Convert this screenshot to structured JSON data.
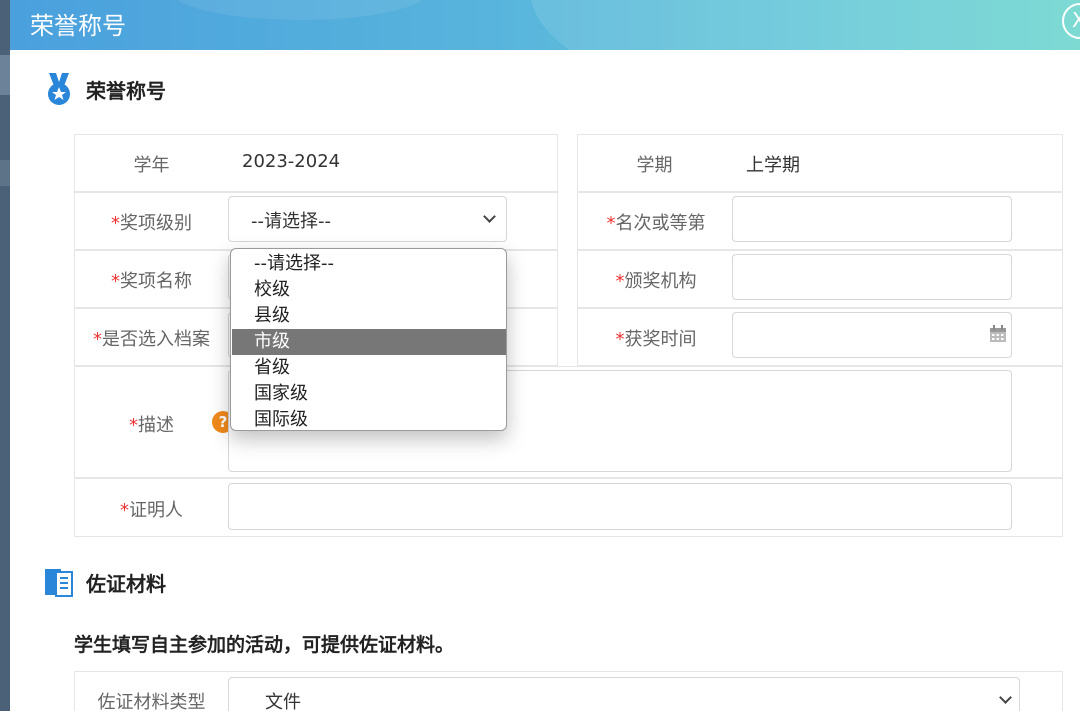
{
  "header": {
    "title": "荣誉称号",
    "close_label": "X"
  },
  "section_honor": {
    "title": "荣誉称号",
    "icon": "medal-icon"
  },
  "form": {
    "year_label": "学年",
    "year_value": "2023-2024",
    "term_label": "学期",
    "term_value": "上学期",
    "required_mark": "*",
    "award_level_label": "奖项级别",
    "award_level_selected": "--请选择--",
    "rank_label": "名次或等第",
    "award_name_label": "奖项名称",
    "issuer_label": "颁奖机构",
    "archive_label": "是否选入档案",
    "award_time_label": "获奖时间",
    "desc_label": "描述",
    "help_glyph": "?",
    "witness_label": "证明人"
  },
  "award_level_options": [
    "--请选择--",
    "校级",
    "县级",
    "市级",
    "省级",
    "国家级",
    "国际级"
  ],
  "highlighted_option": "市级",
  "section_evidence": {
    "title": "佐证材料",
    "icon": "document-icon"
  },
  "evidence_note": "学生填写自主参加的活动，可提供佐证材料。",
  "evidence": {
    "type_label": "佐证材料类型",
    "type_value": "文件"
  },
  "colors": {
    "required": "#ee3333",
    "accent": "#2a86d8",
    "help": "#f08a1c",
    "highlight": "#777777"
  }
}
